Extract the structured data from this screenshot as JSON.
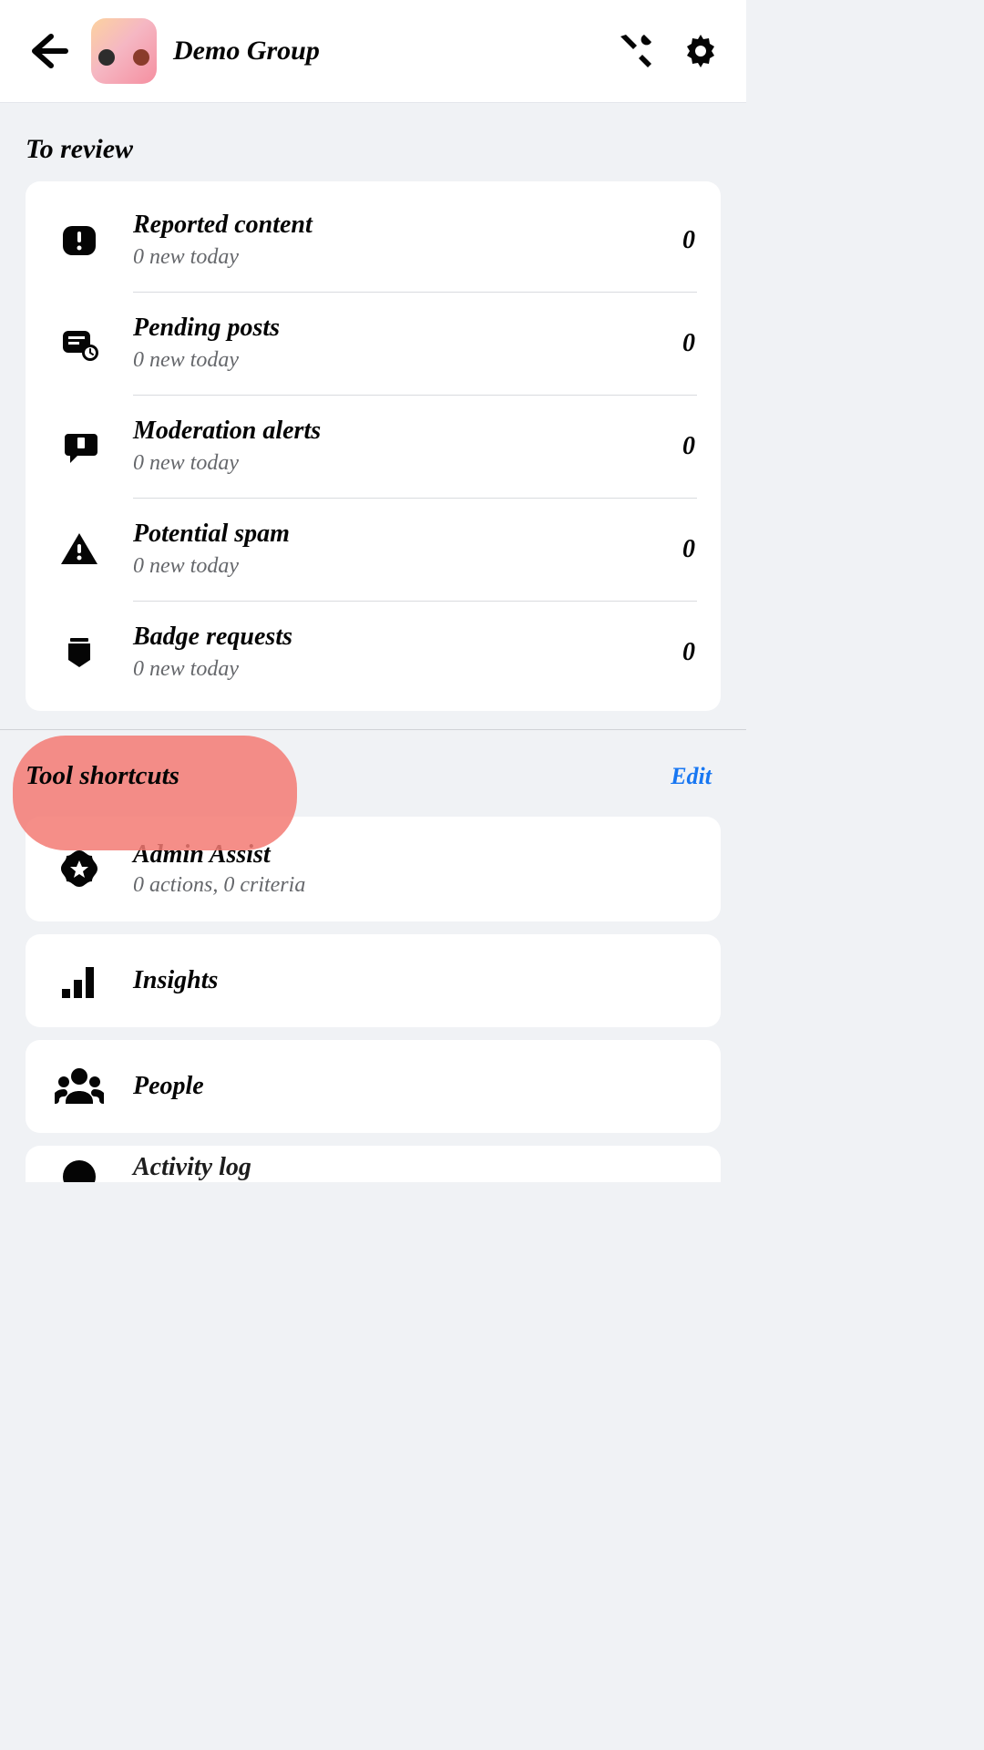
{
  "header": {
    "group_name": "Demo Group"
  },
  "sections": {
    "to_review_title": "To review",
    "tool_shortcuts_title": "Tool shortcuts",
    "edit_label": "Edit"
  },
  "review_items": [
    {
      "title": "Reported content",
      "subtitle": "0 new today",
      "count": "0"
    },
    {
      "title": "Pending posts",
      "subtitle": "0 new today",
      "count": "0"
    },
    {
      "title": "Moderation alerts",
      "subtitle": "0 new today",
      "count": "0"
    },
    {
      "title": "Potential spam",
      "subtitle": "0 new today",
      "count": "0"
    },
    {
      "title": "Badge requests",
      "subtitle": "0 new today",
      "count": "0"
    }
  ],
  "tools": [
    {
      "title": "Admin Assist",
      "subtitle": "0 actions, 0 criteria"
    },
    {
      "title": "Insights",
      "subtitle": ""
    },
    {
      "title": "People",
      "subtitle": ""
    },
    {
      "title": "Activity log",
      "subtitle": ""
    }
  ]
}
